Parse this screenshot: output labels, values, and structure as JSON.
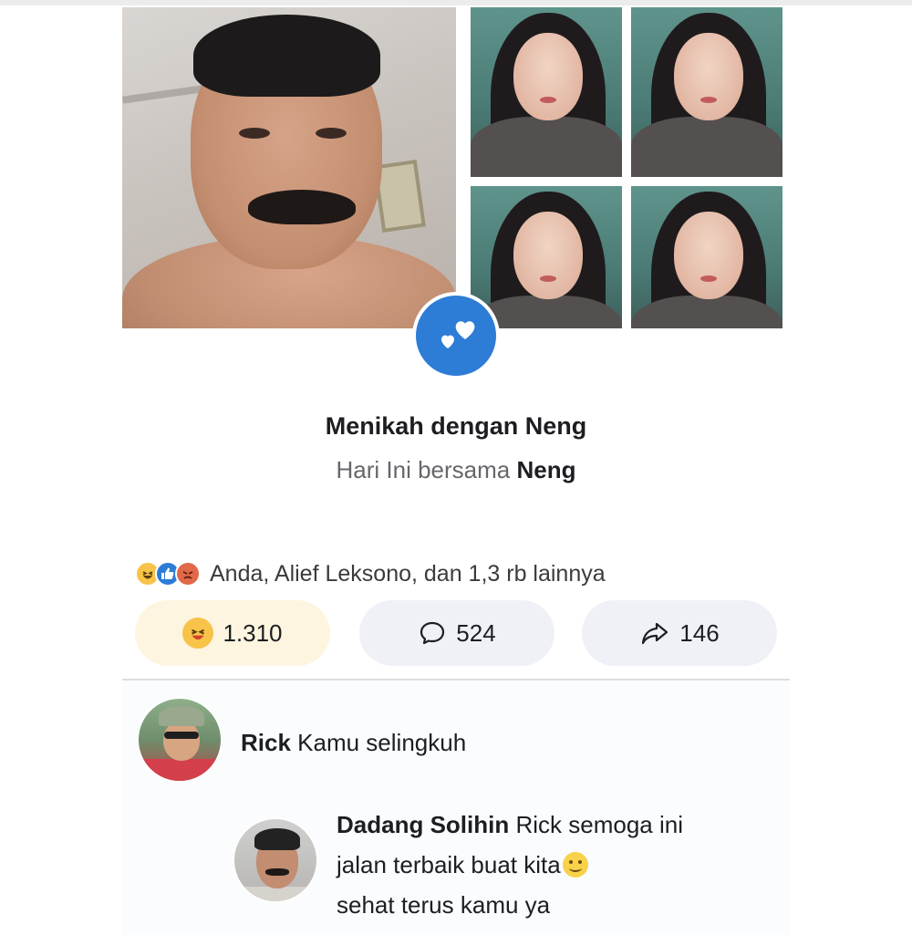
{
  "event": {
    "title": "Menikah dengan Neng",
    "subtitle_prefix": "Hari Ini bersama",
    "subtitle_name": "Neng",
    "badge_icon": "hearts-icon",
    "badge_color": "#2d7cd6"
  },
  "photos": {
    "main": "man-with-mustache-selfie",
    "thumbnails": [
      "woman-in-hijab-1",
      "woman-in-hijab-2",
      "woman-in-hijab-3",
      "woman-in-hijab-4"
    ]
  },
  "reactions": {
    "icons": [
      "haha-icon",
      "like-icon",
      "angry-icon"
    ],
    "summary": "Anda, Alief Leksono, dan 1,3 rb lainnya"
  },
  "actions": {
    "haha": {
      "icon": "haha-icon",
      "count": "1.310"
    },
    "comment": {
      "icon": "comment-icon",
      "count": "524"
    },
    "share": {
      "icon": "share-icon",
      "count": "146"
    }
  },
  "comments": [
    {
      "author": "Rick",
      "text": "Kamu selingkuh"
    },
    {
      "author": "Dadang Solihin",
      "line1": "Rick semoga ini",
      "line2": "jalan terbaik buat kita",
      "emoji": "smile-emoji",
      "line3": "sehat terus kamu ya"
    }
  ]
}
